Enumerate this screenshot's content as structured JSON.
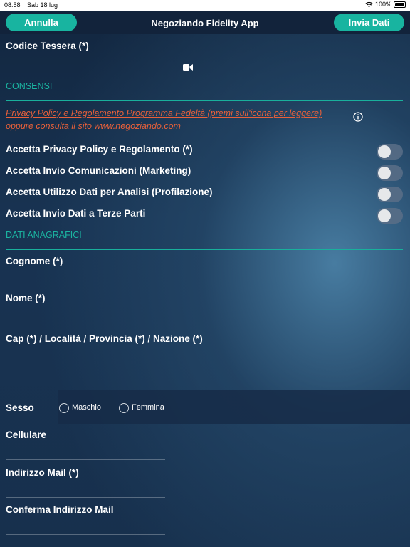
{
  "status_bar": {
    "time": "08:58",
    "date": "Sab 18 lug",
    "battery": "100%"
  },
  "navbar": {
    "cancel_label": "Annulla",
    "title": "Negoziando Fidelity App",
    "submit_label": "Invia Dati"
  },
  "card_field": {
    "label": "Codice Tessera (*)",
    "value": "",
    "camera_icon": "video-camera-icon"
  },
  "consents": {
    "section_title": "CONSENSI",
    "privacy_text": "Privacy Policy e Regolamento Programma Fedeltà (premi sull'icona per leggere) oppure consulta il sito www.negoziando.com",
    "info_icon": "info-icon",
    "toggles": [
      {
        "label": "Accetta Privacy Policy e Regolamento (*)",
        "on": false
      },
      {
        "label": "Accetta Invio Comunicazioni (Marketing)",
        "on": false
      },
      {
        "label": "Accetta Utilizzo Dati per Analisi (Profilazione)",
        "on": false
      },
      {
        "label": "Accetta Invio Dati a Terze Parti",
        "on": false
      }
    ]
  },
  "personal": {
    "section_title": "DATI ANAGRAFICI",
    "surname_label": "Cognome (*)",
    "name_label": "Nome (*)",
    "address_label": "Cap (*) / Località / Provincia (*) / Nazione (*)",
    "gender": {
      "label": "Sesso",
      "options": [
        "Maschio",
        "Femmina"
      ],
      "selected": null
    },
    "mobile_label": "Cellulare",
    "email_label": "Indirizzo Mail (*)",
    "confirm_email_label": "Conferma Indirizzo Mail"
  },
  "colors": {
    "accent": "#19b09c",
    "link": "#e8603a",
    "background": "#17304d"
  }
}
